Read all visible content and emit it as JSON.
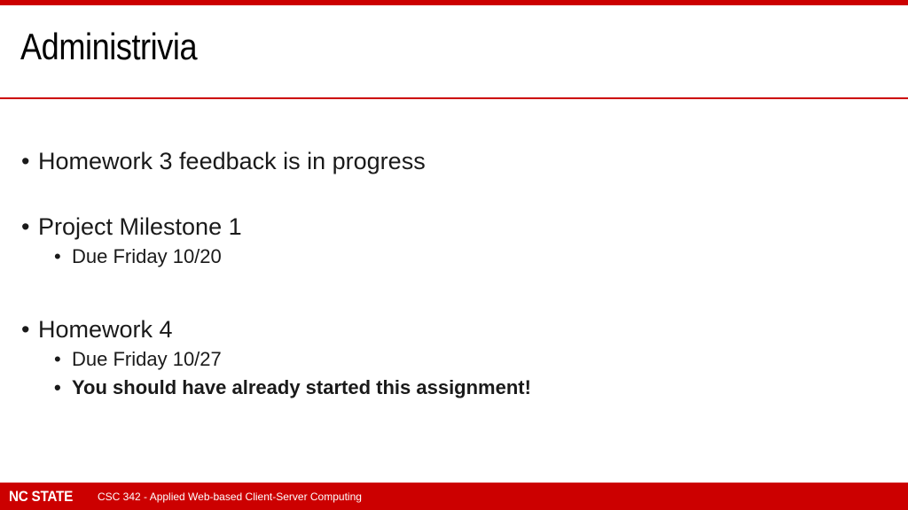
{
  "slide": {
    "title": "Administrivia",
    "bullets": [
      {
        "text": "Homework 3 feedback is in progress",
        "sub": []
      },
      {
        "text": "Project Milestone 1",
        "sub": [
          "Due Friday 10/20"
        ]
      },
      {
        "text": "Homework 4",
        "sub": [
          "Due Friday 10/27",
          "You should have already started this assignment!"
        ]
      }
    ],
    "bullet_glyph": "•"
  },
  "footer": {
    "logo": "NC STATE",
    "course": "CSC 342 - Applied Web-based Client-Server Computing"
  },
  "colors": {
    "accent": "#cc0000",
    "text": "#1a1a1a",
    "background": "#ffffff"
  }
}
